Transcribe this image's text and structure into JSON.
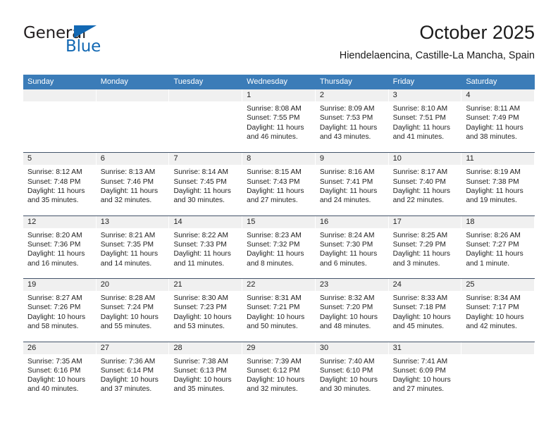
{
  "brand": {
    "name_dark": "General",
    "name_blue": "Blue",
    "accent_color": "#1268b3"
  },
  "header": {
    "title": "October 2025",
    "subtitle": "Hiendelaencina, Castille-La Mancha, Spain"
  },
  "theme": {
    "header_row_bg": "#3b7cb8",
    "header_row_text": "#ffffff",
    "daynum_bg": "#f0f0f0",
    "row_divider": "#44546a",
    "body_text": "#222222"
  },
  "weekdays": [
    "Sunday",
    "Monday",
    "Tuesday",
    "Wednesday",
    "Thursday",
    "Friday",
    "Saturday"
  ],
  "weeks": [
    [
      {
        "day": "",
        "lines": []
      },
      {
        "day": "",
        "lines": []
      },
      {
        "day": "",
        "lines": []
      },
      {
        "day": "1",
        "lines": [
          "Sunrise: 8:08 AM",
          "Sunset: 7:55 PM",
          "Daylight: 11 hours",
          "and 46 minutes."
        ]
      },
      {
        "day": "2",
        "lines": [
          "Sunrise: 8:09 AM",
          "Sunset: 7:53 PM",
          "Daylight: 11 hours",
          "and 43 minutes."
        ]
      },
      {
        "day": "3",
        "lines": [
          "Sunrise: 8:10 AM",
          "Sunset: 7:51 PM",
          "Daylight: 11 hours",
          "and 41 minutes."
        ]
      },
      {
        "day": "4",
        "lines": [
          "Sunrise: 8:11 AM",
          "Sunset: 7:49 PM",
          "Daylight: 11 hours",
          "and 38 minutes."
        ]
      }
    ],
    [
      {
        "day": "5",
        "lines": [
          "Sunrise: 8:12 AM",
          "Sunset: 7:48 PM",
          "Daylight: 11 hours",
          "and 35 minutes."
        ]
      },
      {
        "day": "6",
        "lines": [
          "Sunrise: 8:13 AM",
          "Sunset: 7:46 PM",
          "Daylight: 11 hours",
          "and 32 minutes."
        ]
      },
      {
        "day": "7",
        "lines": [
          "Sunrise: 8:14 AM",
          "Sunset: 7:45 PM",
          "Daylight: 11 hours",
          "and 30 minutes."
        ]
      },
      {
        "day": "8",
        "lines": [
          "Sunrise: 8:15 AM",
          "Sunset: 7:43 PM",
          "Daylight: 11 hours",
          "and 27 minutes."
        ]
      },
      {
        "day": "9",
        "lines": [
          "Sunrise: 8:16 AM",
          "Sunset: 7:41 PM",
          "Daylight: 11 hours",
          "and 24 minutes."
        ]
      },
      {
        "day": "10",
        "lines": [
          "Sunrise: 8:17 AM",
          "Sunset: 7:40 PM",
          "Daylight: 11 hours",
          "and 22 minutes."
        ]
      },
      {
        "day": "11",
        "lines": [
          "Sunrise: 8:19 AM",
          "Sunset: 7:38 PM",
          "Daylight: 11 hours",
          "and 19 minutes."
        ]
      }
    ],
    [
      {
        "day": "12",
        "lines": [
          "Sunrise: 8:20 AM",
          "Sunset: 7:36 PM",
          "Daylight: 11 hours",
          "and 16 minutes."
        ]
      },
      {
        "day": "13",
        "lines": [
          "Sunrise: 8:21 AM",
          "Sunset: 7:35 PM",
          "Daylight: 11 hours",
          "and 14 minutes."
        ]
      },
      {
        "day": "14",
        "lines": [
          "Sunrise: 8:22 AM",
          "Sunset: 7:33 PM",
          "Daylight: 11 hours",
          "and 11 minutes."
        ]
      },
      {
        "day": "15",
        "lines": [
          "Sunrise: 8:23 AM",
          "Sunset: 7:32 PM",
          "Daylight: 11 hours",
          "and 8 minutes."
        ]
      },
      {
        "day": "16",
        "lines": [
          "Sunrise: 8:24 AM",
          "Sunset: 7:30 PM",
          "Daylight: 11 hours",
          "and 6 minutes."
        ]
      },
      {
        "day": "17",
        "lines": [
          "Sunrise: 8:25 AM",
          "Sunset: 7:29 PM",
          "Daylight: 11 hours",
          "and 3 minutes."
        ]
      },
      {
        "day": "18",
        "lines": [
          "Sunrise: 8:26 AM",
          "Sunset: 7:27 PM",
          "Daylight: 11 hours",
          "and 1 minute."
        ]
      }
    ],
    [
      {
        "day": "19",
        "lines": [
          "Sunrise: 8:27 AM",
          "Sunset: 7:26 PM",
          "Daylight: 10 hours",
          "and 58 minutes."
        ]
      },
      {
        "day": "20",
        "lines": [
          "Sunrise: 8:28 AM",
          "Sunset: 7:24 PM",
          "Daylight: 10 hours",
          "and 55 minutes."
        ]
      },
      {
        "day": "21",
        "lines": [
          "Sunrise: 8:30 AM",
          "Sunset: 7:23 PM",
          "Daylight: 10 hours",
          "and 53 minutes."
        ]
      },
      {
        "day": "22",
        "lines": [
          "Sunrise: 8:31 AM",
          "Sunset: 7:21 PM",
          "Daylight: 10 hours",
          "and 50 minutes."
        ]
      },
      {
        "day": "23",
        "lines": [
          "Sunrise: 8:32 AM",
          "Sunset: 7:20 PM",
          "Daylight: 10 hours",
          "and 48 minutes."
        ]
      },
      {
        "day": "24",
        "lines": [
          "Sunrise: 8:33 AM",
          "Sunset: 7:18 PM",
          "Daylight: 10 hours",
          "and 45 minutes."
        ]
      },
      {
        "day": "25",
        "lines": [
          "Sunrise: 8:34 AM",
          "Sunset: 7:17 PM",
          "Daylight: 10 hours",
          "and 42 minutes."
        ]
      }
    ],
    [
      {
        "day": "26",
        "lines": [
          "Sunrise: 7:35 AM",
          "Sunset: 6:16 PM",
          "Daylight: 10 hours",
          "and 40 minutes."
        ]
      },
      {
        "day": "27",
        "lines": [
          "Sunrise: 7:36 AM",
          "Sunset: 6:14 PM",
          "Daylight: 10 hours",
          "and 37 minutes."
        ]
      },
      {
        "day": "28",
        "lines": [
          "Sunrise: 7:38 AM",
          "Sunset: 6:13 PM",
          "Daylight: 10 hours",
          "and 35 minutes."
        ]
      },
      {
        "day": "29",
        "lines": [
          "Sunrise: 7:39 AM",
          "Sunset: 6:12 PM",
          "Daylight: 10 hours",
          "and 32 minutes."
        ]
      },
      {
        "day": "30",
        "lines": [
          "Sunrise: 7:40 AM",
          "Sunset: 6:10 PM",
          "Daylight: 10 hours",
          "and 30 minutes."
        ]
      },
      {
        "day": "31",
        "lines": [
          "Sunrise: 7:41 AM",
          "Sunset: 6:09 PM",
          "Daylight: 10 hours",
          "and 27 minutes."
        ]
      },
      {
        "day": "",
        "lines": []
      }
    ]
  ]
}
